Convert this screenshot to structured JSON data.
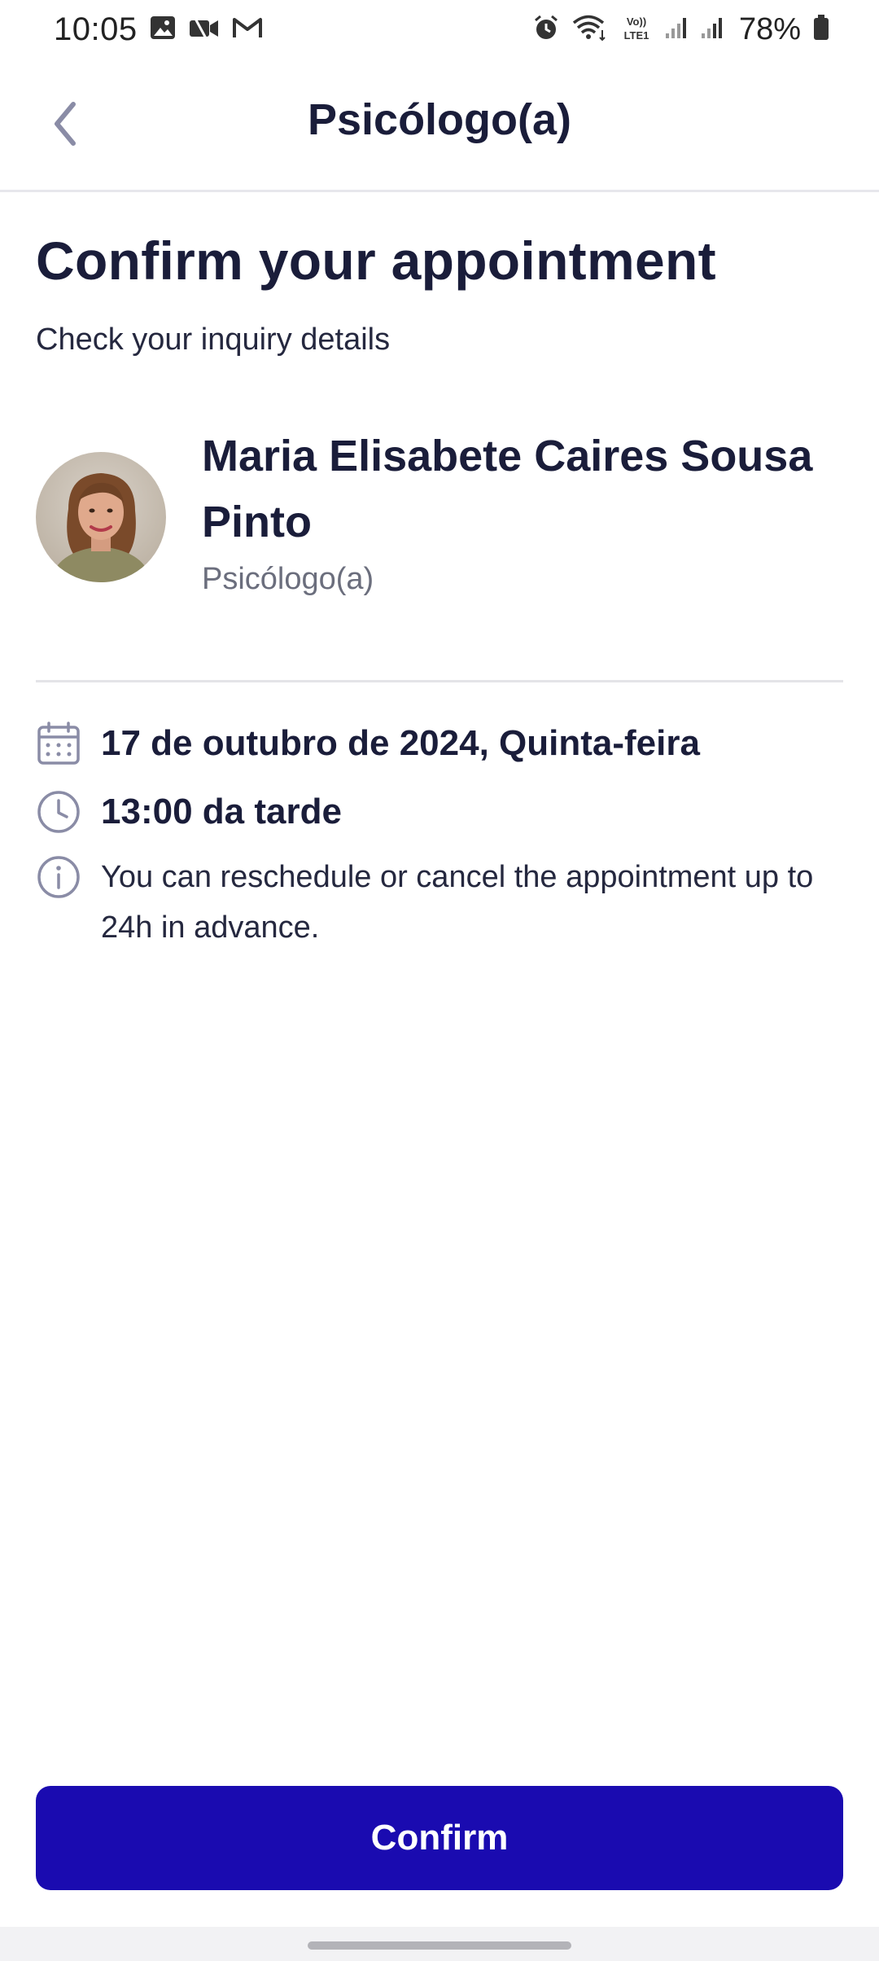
{
  "status_bar": {
    "time": "10:05",
    "battery": "78%",
    "icons_left": [
      "gallery-icon",
      "video-call-icon",
      "gmail-icon"
    ],
    "icons_right": [
      "alarm-icon",
      "wifi-icon",
      "volte-icon",
      "signal-icon",
      "signal-icon",
      "battery-icon"
    ]
  },
  "header": {
    "title": "Psicólogo(a)",
    "back_icon": "chevron-left-icon"
  },
  "main": {
    "title": "Confirm your appointment",
    "subtitle": "Check your inquiry details"
  },
  "professional": {
    "name": "Maria Elisabete Caires Sousa Pinto",
    "role": "Psicólogo(a)"
  },
  "details": {
    "date": "17 de outubro de 2024, Quinta-feira",
    "time": "13:00 da tarde",
    "note": "You can reschedule or cancel the appointment up to 24h in advance."
  },
  "actions": {
    "confirm_label": "Confirm"
  },
  "colors": {
    "primary": "#1a0bb0",
    "text_dark": "#1a1d3a",
    "text_muted": "#6b6e7d",
    "icon": "#8a8ca6"
  }
}
